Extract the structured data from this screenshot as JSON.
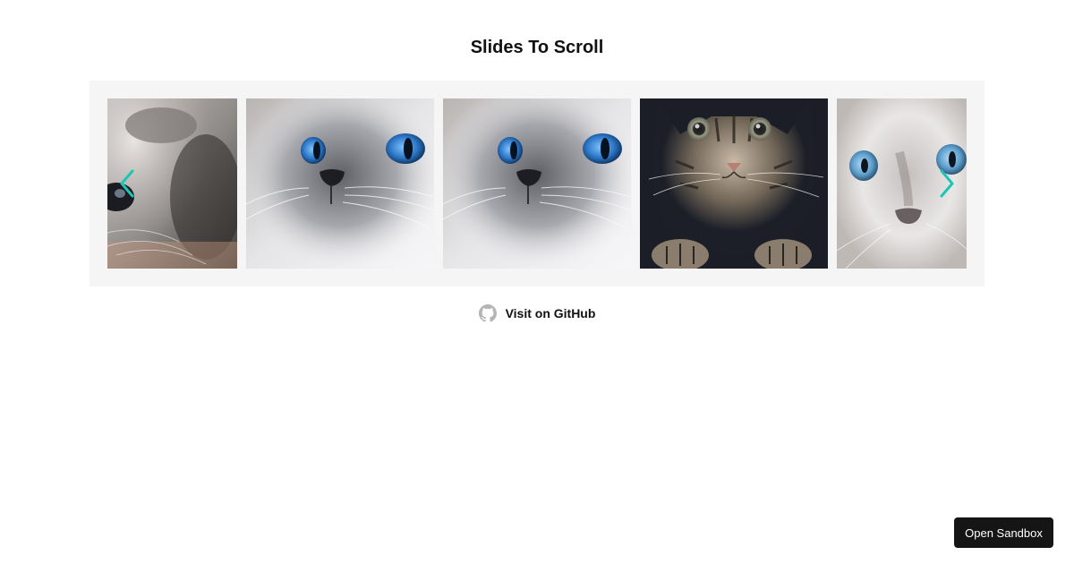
{
  "page": {
    "title": "Slides To Scroll"
  },
  "carousel": {
    "prev_icon": "chevron-left-icon",
    "next_icon": "chevron-right-icon",
    "arrow_color": "#1cc6b6",
    "background": "#f5f5f5",
    "slides": [
      {
        "image": "kitten-closeup-eye"
      },
      {
        "image": "white-cat-blue-eyes"
      },
      {
        "image": "white-cat-blue-eyes"
      },
      {
        "image": "tabby-kitten"
      },
      {
        "image": "white-kitten-blue-eyes"
      }
    ]
  },
  "github_link": {
    "icon": "github-icon",
    "label": "Visit on GitHub"
  },
  "sandbox_button": {
    "label": "Open Sandbox"
  }
}
